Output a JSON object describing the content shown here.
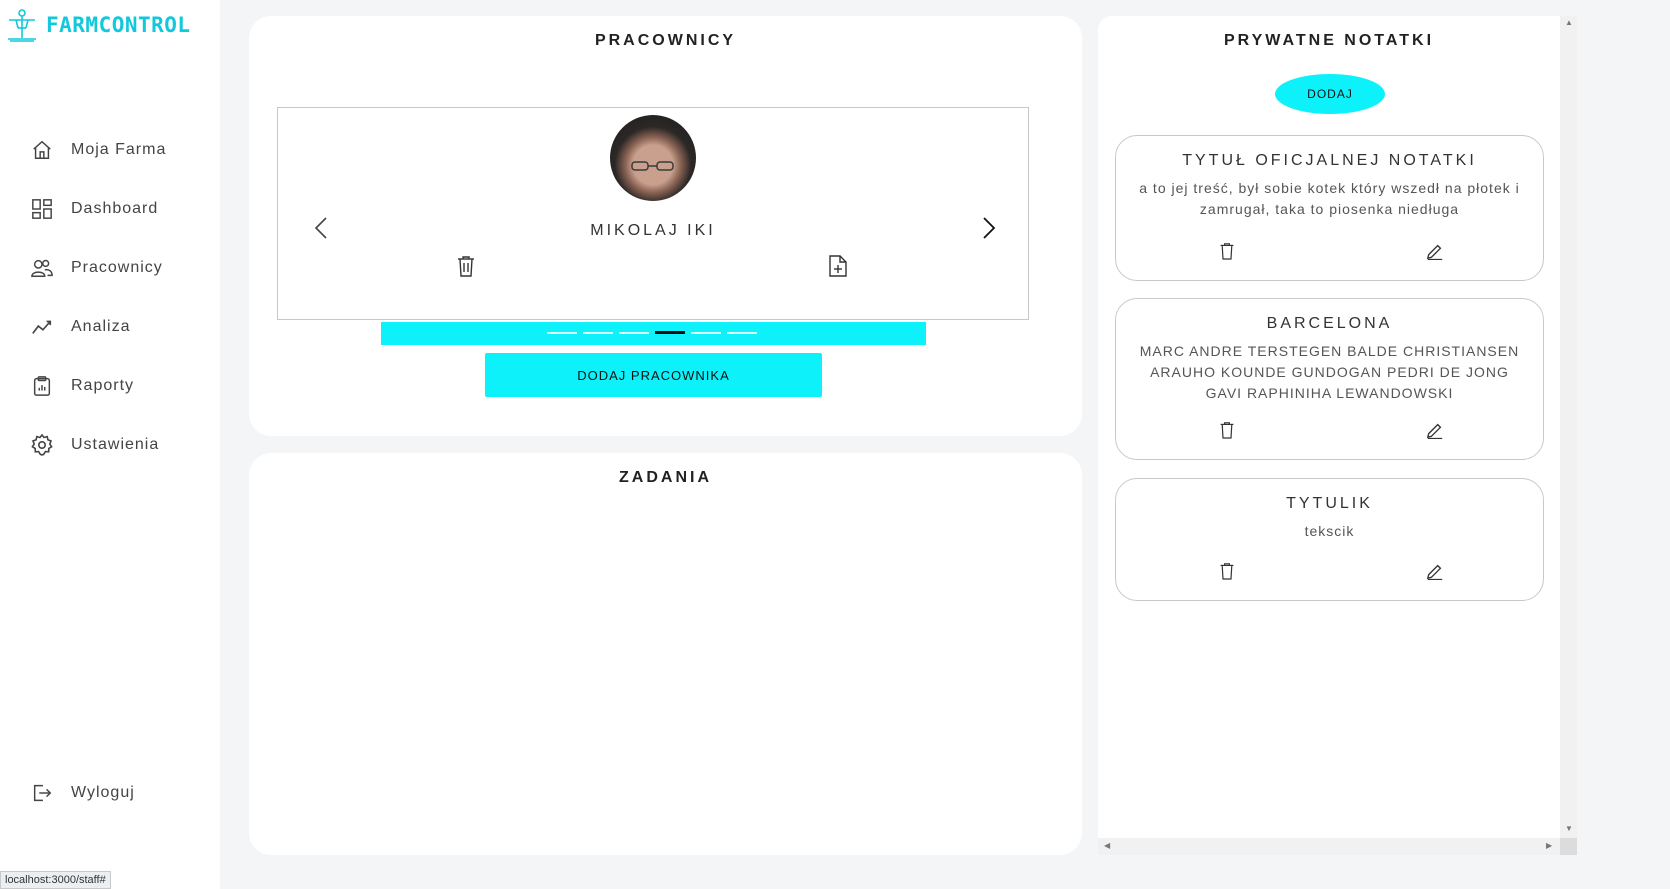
{
  "app": {
    "logo_text": "FARMCONTROL"
  },
  "sidebar": {
    "items": [
      {
        "label": "Moja Farma",
        "icon": "home-icon"
      },
      {
        "label": "Dashboard",
        "icon": "dashboard-icon"
      },
      {
        "label": "Pracownicy",
        "icon": "users-icon"
      },
      {
        "label": "Analiza",
        "icon": "chart-line-icon"
      },
      {
        "label": "Raporty",
        "icon": "clipboard-icon"
      },
      {
        "label": "Ustawienia",
        "icon": "gear-icon"
      }
    ],
    "logout_label": "Wyloguj"
  },
  "status_bar": {
    "url": "localhost:3000/staff#"
  },
  "staff": {
    "title": "PRACOWNICY",
    "current_worker": {
      "name": "MIKOLAJ IKI"
    },
    "carousel": {
      "slide_count": 6,
      "active_index": 3
    },
    "add_button_label": "DODAJ PRACOWNIKA"
  },
  "tasks": {
    "title": "ZADANIA"
  },
  "notes": {
    "title": "PRYWATNE NOTATKI",
    "add_button_label": "DODAJ",
    "items": [
      {
        "title": "TYTUŁ OFICJALNEJ NOTATKI",
        "body": "a to jej treść, był sobie kotek który wszedł na płotek i zamrugał, taka to piosenka niedługa"
      },
      {
        "title": "BARCELONA",
        "body": "MARC ANDRE TERSTEGEN BALDE CHRISTIANSEN ARAUHO KOUNDE GUNDOGAN PEDRI DE JONG GAVI RAPHINIHA LEWANDOWSKI"
      },
      {
        "title": "TYTULIK",
        "body": "tekscik"
      }
    ]
  },
  "colors": {
    "accent": "#0df2fa",
    "logo": "#12c8dc"
  }
}
